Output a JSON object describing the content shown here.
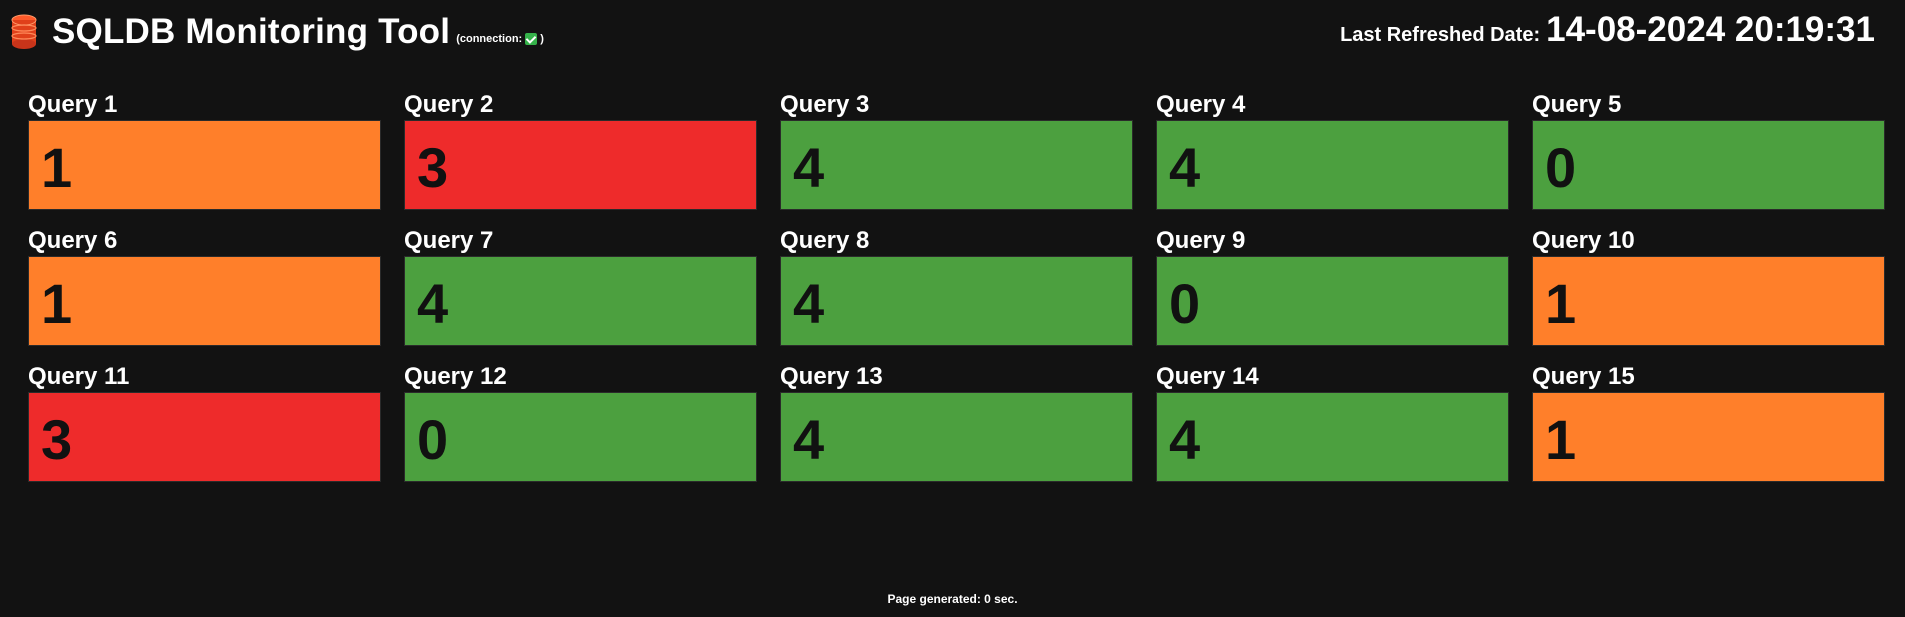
{
  "header": {
    "title": "SQLDB Monitoring Tool",
    "connection_label": "(connection:",
    "connection_close": ")",
    "connection_icon": "check-icon",
    "connection_status": "ok",
    "refreshed_label": "Last Refreshed Date:",
    "refreshed_value": "14-08-2024 20:19:31"
  },
  "colors": {
    "background": "#121212",
    "orange": "#ff7f2a",
    "red": "#ee2b2b",
    "green": "#4ca03f"
  },
  "queries": [
    {
      "title": "Query 1",
      "value": "1",
      "status": "orange"
    },
    {
      "title": "Query 2",
      "value": "3",
      "status": "red"
    },
    {
      "title": "Query 3",
      "value": "4",
      "status": "green"
    },
    {
      "title": "Query 4",
      "value": "4",
      "status": "green"
    },
    {
      "title": "Query 5",
      "value": "0",
      "status": "green"
    },
    {
      "title": "Query 6",
      "value": "1",
      "status": "orange"
    },
    {
      "title": "Query 7",
      "value": "4",
      "status": "green"
    },
    {
      "title": "Query 8",
      "value": "4",
      "status": "green"
    },
    {
      "title": "Query 9",
      "value": "0",
      "status": "green"
    },
    {
      "title": "Query 10",
      "value": "1",
      "status": "orange"
    },
    {
      "title": "Query 11",
      "value": "3",
      "status": "red"
    },
    {
      "title": "Query 12",
      "value": "0",
      "status": "green"
    },
    {
      "title": "Query 13",
      "value": "4",
      "status": "green"
    },
    {
      "title": "Query 14",
      "value": "4",
      "status": "green"
    },
    {
      "title": "Query 15",
      "value": "1",
      "status": "orange"
    }
  ],
  "footer": {
    "text": "Page generated: 0 sec."
  }
}
